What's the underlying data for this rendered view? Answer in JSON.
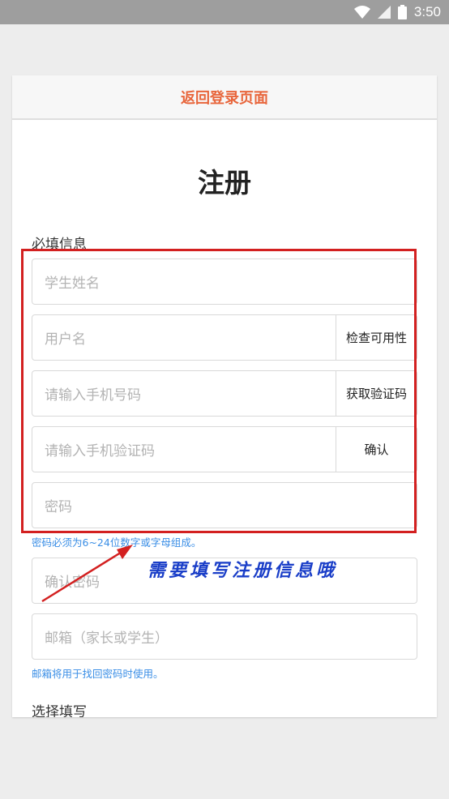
{
  "status_bar": {
    "time": "3:50",
    "icons": [
      "wifi-icon",
      "signal-icon",
      "battery-icon"
    ]
  },
  "header": {
    "back_link": "返回登录页面"
  },
  "page_title": "注册",
  "required_section": {
    "label": "必填信息",
    "fields": {
      "student_name": {
        "placeholder": "学生姓名"
      },
      "username": {
        "placeholder": "用户名",
        "action": "检查可用性"
      },
      "phone": {
        "placeholder": "请输入手机号码",
        "action": "获取验证码"
      },
      "sms_code": {
        "placeholder": "请输入手机验证码",
        "action": "确认"
      },
      "password": {
        "placeholder": "密码",
        "hint": "密码必须为6~24位数字或字母组成。"
      },
      "confirm_password": {
        "placeholder": "确认密码"
      },
      "email": {
        "placeholder": "邮箱（家长或学生）",
        "hint": "邮箱将用于找回密码时使用。"
      }
    }
  },
  "optional_section": {
    "label": "选择填写"
  },
  "annotation": {
    "text": "需要填写注册信息哦",
    "colors": {
      "box": "#d32020",
      "text": "#1a3ec8"
    }
  },
  "colors": {
    "accent": "#e8663c",
    "hint": "#3a8ee6",
    "status_bar": "#9e9e9e"
  }
}
